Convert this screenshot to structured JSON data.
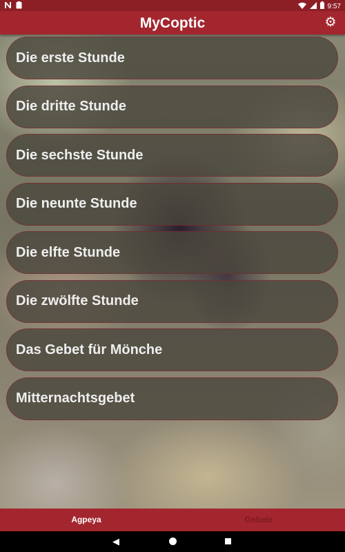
{
  "status_bar": {
    "time": "9:57",
    "left_icons": [
      "n-icon",
      "clipboard-icon"
    ],
    "right_icons": [
      "wifi-icon",
      "signal-icon",
      "battery-icon"
    ]
  },
  "app_bar": {
    "title": "MyCoptic",
    "settings_icon": "gear-icon"
  },
  "prayer_list": {
    "items": [
      {
        "label": "Die erste Stunde"
      },
      {
        "label": "Die dritte Stunde"
      },
      {
        "label": "Die sechste Stunde"
      },
      {
        "label": "Die neunte Stunde"
      },
      {
        "label": "Die elfte Stunde"
      },
      {
        "label": "Die zwölfte Stunde"
      },
      {
        "label": "Das Gebet für Mönche"
      },
      {
        "label": "Mitternachtsgebet"
      }
    ]
  },
  "bottom_nav": {
    "tabs": [
      {
        "label": "Agpeya",
        "active": true
      },
      {
        "label": "Gebete",
        "active": false
      }
    ]
  },
  "colors": {
    "primary": "#a3262e",
    "status_bar": "#8c1f26",
    "inactive_tab_text": "#7f1a20",
    "item_text": "#eeeeee"
  }
}
